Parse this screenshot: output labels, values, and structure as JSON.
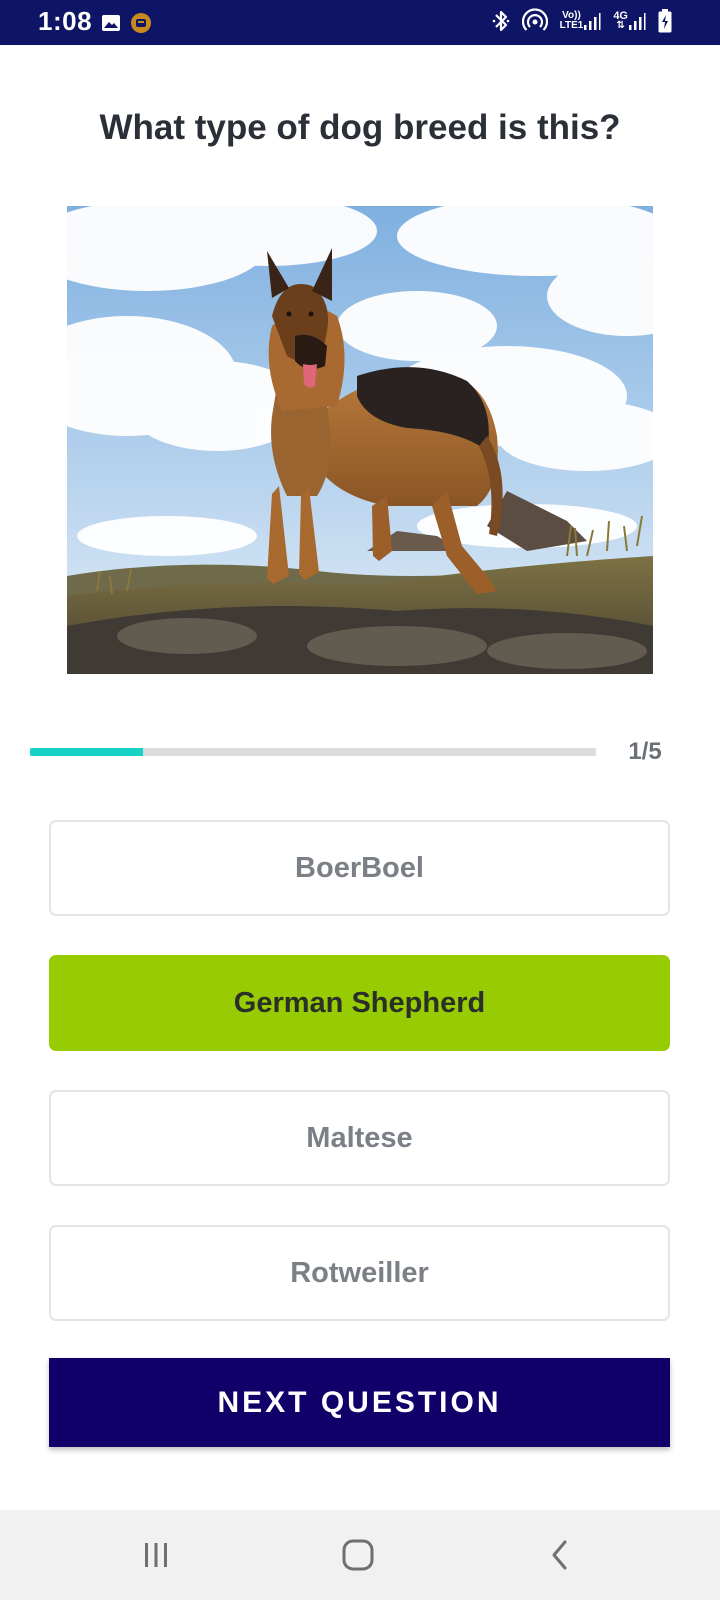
{
  "status_bar": {
    "time": "1:08",
    "left_icons": [
      "image-icon",
      "notification-badge-icon"
    ],
    "right_icons": [
      "bluetooth-icon",
      "hotspot-icon",
      "volte-signal-icon",
      "4g-signal-icon",
      "battery-charging-icon"
    ],
    "volte_top": "Vo))",
    "volte_bottom": "LTE1",
    "net_top": "4G",
    "net_bottom": "⇅",
    "background": "#0f1566"
  },
  "quiz": {
    "question": "What type of dog breed is this?",
    "progress": {
      "current": 1,
      "total": 5,
      "fraction": 0.2,
      "label": "1/5",
      "fill_color": "#16d3c6"
    },
    "options": [
      {
        "label": "BoerBoel",
        "selected": false
      },
      {
        "label": "German Shepherd",
        "selected": true
      },
      {
        "label": "Maltese",
        "selected": false
      },
      {
        "label": "Rotweiller",
        "selected": false
      }
    ],
    "selected_color": "#97cb02",
    "next_button_label": "NEXT QUESTION",
    "next_button_color": "#12006a"
  },
  "nav_bar": {
    "buttons": [
      "recent-apps-icon",
      "home-icon",
      "back-icon"
    ]
  }
}
